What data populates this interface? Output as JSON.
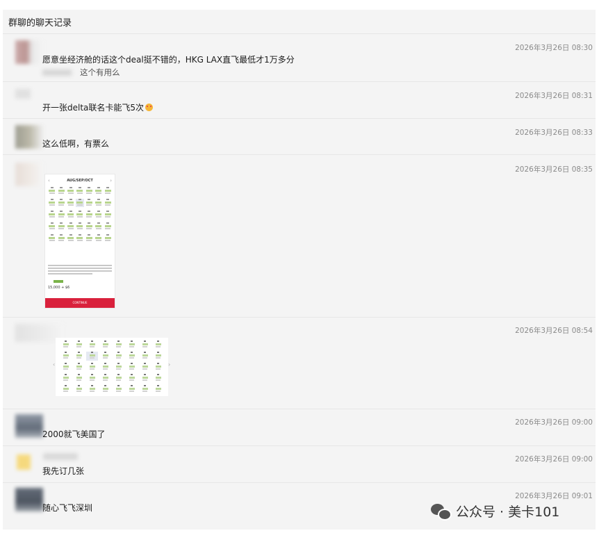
{
  "window": {
    "title": "群聊的聊天记录"
  },
  "messages": [
    {
      "time": "2026年3月26日 08:30",
      "text": "愿意坐经济舱的话这个deal挺不错的，HKG LAX直飞最低才1万多分",
      "quote": "这个有用么"
    },
    {
      "time": "2026年3月26日 08:31",
      "text": "开一张delta联名卡能飞5次"
    },
    {
      "time": "2026年3月26日 08:33",
      "text": "这么低啊，有票么"
    },
    {
      "time": "2026年3月26日 08:35",
      "image": {
        "month": "AUG/SEP/OCT",
        "price": "15,000",
        "price_suffix": "+ $6",
        "cta": "CONTINUE"
      }
    },
    {
      "time": "2026年3月26日 08:54"
    },
    {
      "time": "2026年3月26日 09:00",
      "text": "2000就飞美国了"
    },
    {
      "time": "2026年3月26日 09:00",
      "text": "我先订几张"
    },
    {
      "time": "2026年3月26日 09:01",
      "text": "随心飞飞深圳"
    }
  ],
  "watermark": {
    "text": "公众号 · 美卡101",
    "icon": "wechat-icon"
  },
  "colors": {
    "background": "#f4f4f4",
    "cta": "#d9213c",
    "award_green": "#b8d58d"
  }
}
